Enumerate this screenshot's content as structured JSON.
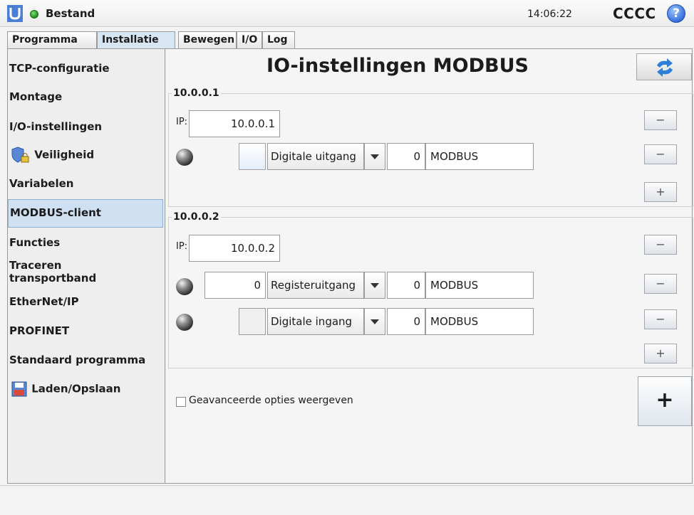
{
  "header": {
    "file_name": "Bestand",
    "time": "14:06:22",
    "user": "CCCC",
    "help": "?"
  },
  "tabs": [
    {
      "label": "Programma"
    },
    {
      "label": "Installatie",
      "active": true
    },
    {
      "label": "Bewegen"
    },
    {
      "label": "I/O"
    },
    {
      "label": "Log"
    }
  ],
  "sidebar": {
    "items": [
      {
        "label": "TCP-configuratie"
      },
      {
        "label": "Montage"
      },
      {
        "label": "I/O-instellingen"
      },
      {
        "label": "Veiligheid"
      },
      {
        "label": "Variabelen"
      },
      {
        "label": "MODBUS-client",
        "selected": true
      },
      {
        "label": "Functies"
      },
      {
        "label": "Traceren transportband"
      },
      {
        "label": "EtherNet/IP"
      },
      {
        "label": "PROFINET"
      },
      {
        "label": "Standaard programma"
      },
      {
        "label": "Laden/Opslaan"
      }
    ]
  },
  "main": {
    "title": "IO-instellingen MODBUS",
    "ip_label": "IP:",
    "units": [
      {
        "name": "10.0.0.1",
        "ip": "10.0.0.1",
        "signals": [
          {
            "value": "",
            "type": "Digitale uitgang",
            "address": "0",
            "name": "MODBUS"
          }
        ]
      },
      {
        "name": "10.0.0.2",
        "ip": "10.0.0.2",
        "signals": [
          {
            "value": "0",
            "type": "Registeruitgang",
            "address": "0",
            "name": "MODBUS"
          },
          {
            "value": "",
            "type": "Digitale ingang",
            "address": "0",
            "name": "MODBUS"
          }
        ]
      }
    ],
    "advanced_label": "Geavanceerde opties weergeven",
    "add_label": "+",
    "minus_label": "−",
    "plus_label": "+"
  }
}
